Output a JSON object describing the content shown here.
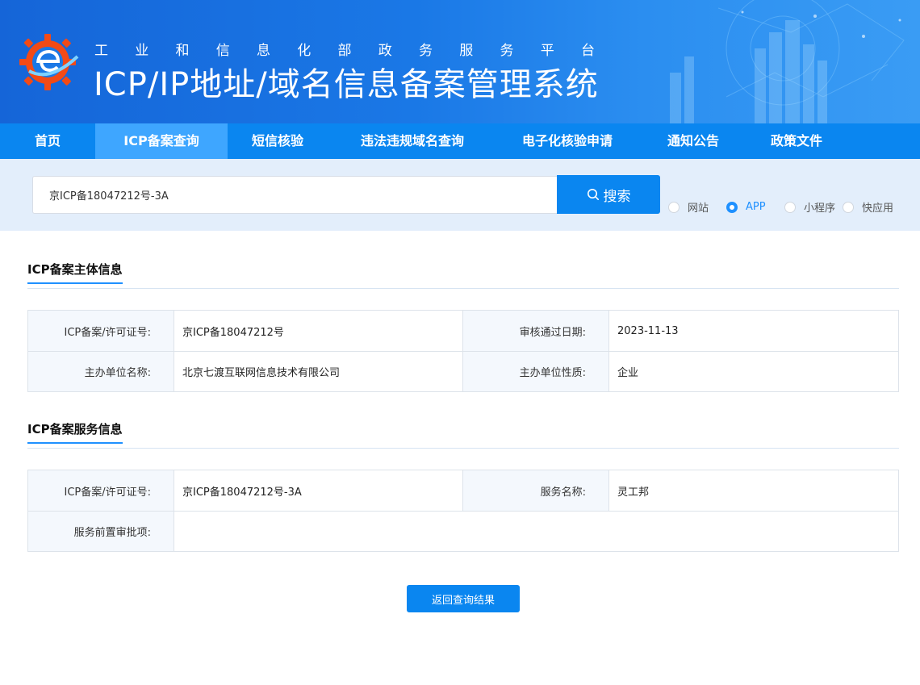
{
  "header": {
    "subtitle_chars": [
      "工",
      "业",
      "和",
      "信",
      "息",
      "化",
      "部",
      "政",
      "务",
      "服",
      "务",
      "平",
      "台"
    ],
    "title": "ICP/IP地址/域名信息备案管理系统",
    "logo_icon": "gear-e-logo-icon"
  },
  "nav": {
    "items": [
      {
        "label": "首页"
      },
      {
        "label": "ICP备案查询",
        "active": true
      },
      {
        "label": "短信核验"
      },
      {
        "label": "违法违规域名查询"
      },
      {
        "label": "电子化核验申请"
      },
      {
        "label": "通知公告"
      },
      {
        "label": "政策文件"
      }
    ]
  },
  "search": {
    "value": "京ICP备18047212号-3A",
    "button_label": "搜索",
    "button_icon": "search-icon",
    "options": [
      {
        "label": "网站",
        "checked": false
      },
      {
        "label": "APP",
        "checked": true
      },
      {
        "label": "小程序",
        "checked": false
      },
      {
        "label": "快应用",
        "checked": false
      }
    ]
  },
  "entity_section": {
    "title": "ICP备案主体信息",
    "license_label": "ICP备案/许可证号:",
    "license_value": "京ICP备18047212号",
    "approval_date_label": "审核通过日期:",
    "approval_date_value": "2023-11-13",
    "org_name_label": "主办单位名称:",
    "org_name_value": "北京七渡互联网信息技术有限公司",
    "org_type_label": "主办单位性质:",
    "org_type_value": "企业"
  },
  "service_section": {
    "title": "ICP备案服务信息",
    "license_label": "ICP备案/许可证号:",
    "license_value": "京ICP备18047212号-3A",
    "service_name_label": "服务名称:",
    "service_name_value": "灵工邦",
    "pre_approval_label": "服务前置审批项:",
    "pre_approval_value": ""
  },
  "back_button_label": "返回查询结果",
  "colors": {
    "primary": "#0a86f0",
    "nav_active": "#3ea6ff",
    "search_band": "#e3eefb",
    "label_bg": "#f4f8fd"
  }
}
